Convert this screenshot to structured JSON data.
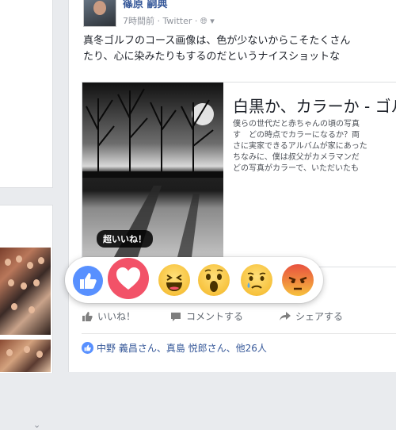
{
  "post": {
    "author": "篠原 嗣典",
    "time": "7時間前",
    "source": "Twitter",
    "text_lines": [
      "真冬ゴルフのコース画像は、色が少ないからこそたくさん",
      "たり、心に染みたりもするのだというナイスショットな"
    ]
  },
  "link": {
    "title": "白黒か、カラーか - ゴル",
    "desc_lines": [
      "僕らの世代だと赤ちゃんの頃の写真",
      "す　どの時点でカラーになるか？両",
      "さに実家できるアルバムが家にあった",
      "ちなみに、僕は叔父がカメラマンだ",
      "どの写真がカラーで、いただいたも"
    ],
    "image_badge": "超いいね！"
  },
  "reactions": [
    "like",
    "love",
    "haha",
    "wow",
    "sad",
    "angry"
  ],
  "actions": {
    "like": "いいね！",
    "comment": "コメントする",
    "share": "シェアする"
  },
  "reactors": "中野 義昌さん、真島 悦郎さん、他26人",
  "colors": {
    "link_blue": "#365899",
    "like_blue": "#5890ff",
    "love_red": "#f25268",
    "emoji_yellow": "#f7c23d",
    "angry_red": "#e8523f"
  }
}
